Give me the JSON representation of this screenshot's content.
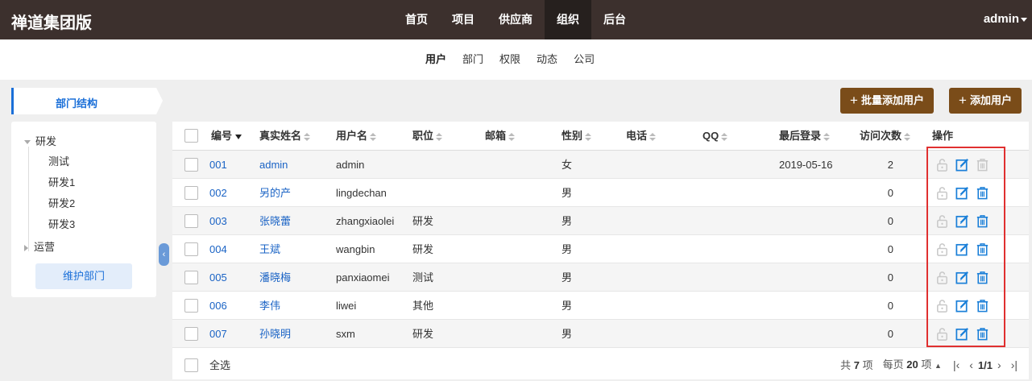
{
  "app": {
    "brand": "禅道集团版",
    "user": "admin"
  },
  "main_nav": [
    {
      "label": "首页",
      "active": false
    },
    {
      "label": "项目",
      "active": false
    },
    {
      "label": "供应商",
      "active": false
    },
    {
      "label": "组织",
      "active": true
    },
    {
      "label": "后台",
      "active": false
    }
  ],
  "sub_nav": [
    {
      "label": "用户",
      "active": true
    },
    {
      "label": "部门",
      "active": false
    },
    {
      "label": "权限",
      "active": false
    },
    {
      "label": "动态",
      "active": false
    },
    {
      "label": "公司",
      "active": false
    }
  ],
  "sidebar": {
    "title": "部门结构",
    "tree": [
      {
        "label": "研发",
        "expanded": true,
        "children": [
          "测试",
          "研发1",
          "研发2",
          "研发3"
        ]
      },
      {
        "label": "运营",
        "expanded": false,
        "children": []
      }
    ],
    "maintain_button": "维护部门"
  },
  "actions": {
    "batch_add": "批量添加用户",
    "add": "添加用户"
  },
  "table": {
    "columns": [
      "编号",
      "真实姓名",
      "用户名",
      "职位",
      "邮箱",
      "性别",
      "电话",
      "QQ",
      "最后登录",
      "访问次数",
      "操作"
    ],
    "rows": [
      {
        "id": "001",
        "realname": "admin",
        "account": "admin",
        "role": "",
        "email": "",
        "gender": "女",
        "phone": "",
        "qq": "",
        "last_login": "2019-05-16",
        "visits": "2"
      },
      {
        "id": "002",
        "realname": "另的产",
        "account": "lingdechan",
        "role": "",
        "email": "",
        "gender": "男",
        "phone": "",
        "qq": "",
        "last_login": "",
        "visits": "0"
      },
      {
        "id": "003",
        "realname": "张晓蕾",
        "account": "zhangxiaolei",
        "role": "研发",
        "email": "",
        "gender": "男",
        "phone": "",
        "qq": "",
        "last_login": "",
        "visits": "0"
      },
      {
        "id": "004",
        "realname": "王斌",
        "account": "wangbin",
        "role": "研发",
        "email": "",
        "gender": "男",
        "phone": "",
        "qq": "",
        "last_login": "",
        "visits": "0"
      },
      {
        "id": "005",
        "realname": "潘晓梅",
        "account": "panxiaomei",
        "role": "测试",
        "email": "",
        "gender": "男",
        "phone": "",
        "qq": "",
        "last_login": "",
        "visits": "0"
      },
      {
        "id": "006",
        "realname": "李伟",
        "account": "liwei",
        "role": "其他",
        "email": "",
        "gender": "男",
        "phone": "",
        "qq": "",
        "last_login": "",
        "visits": "0"
      },
      {
        "id": "007",
        "realname": "孙晓明",
        "account": "sxm",
        "role": "研发",
        "email": "",
        "gender": "男",
        "phone": "",
        "qq": "",
        "last_login": "",
        "visits": "0"
      }
    ],
    "select_all": "全选"
  },
  "pager": {
    "total_prefix": "共",
    "total": "7",
    "total_suffix": "项",
    "per_page_prefix": "每页",
    "per_page": "20",
    "per_page_suffix": "项",
    "page": "1/1"
  },
  "colors": {
    "header": "#3c302d",
    "accent": "#1a6fd8",
    "brown_button": "#7a4c19",
    "highlight_box": "#e03030"
  }
}
